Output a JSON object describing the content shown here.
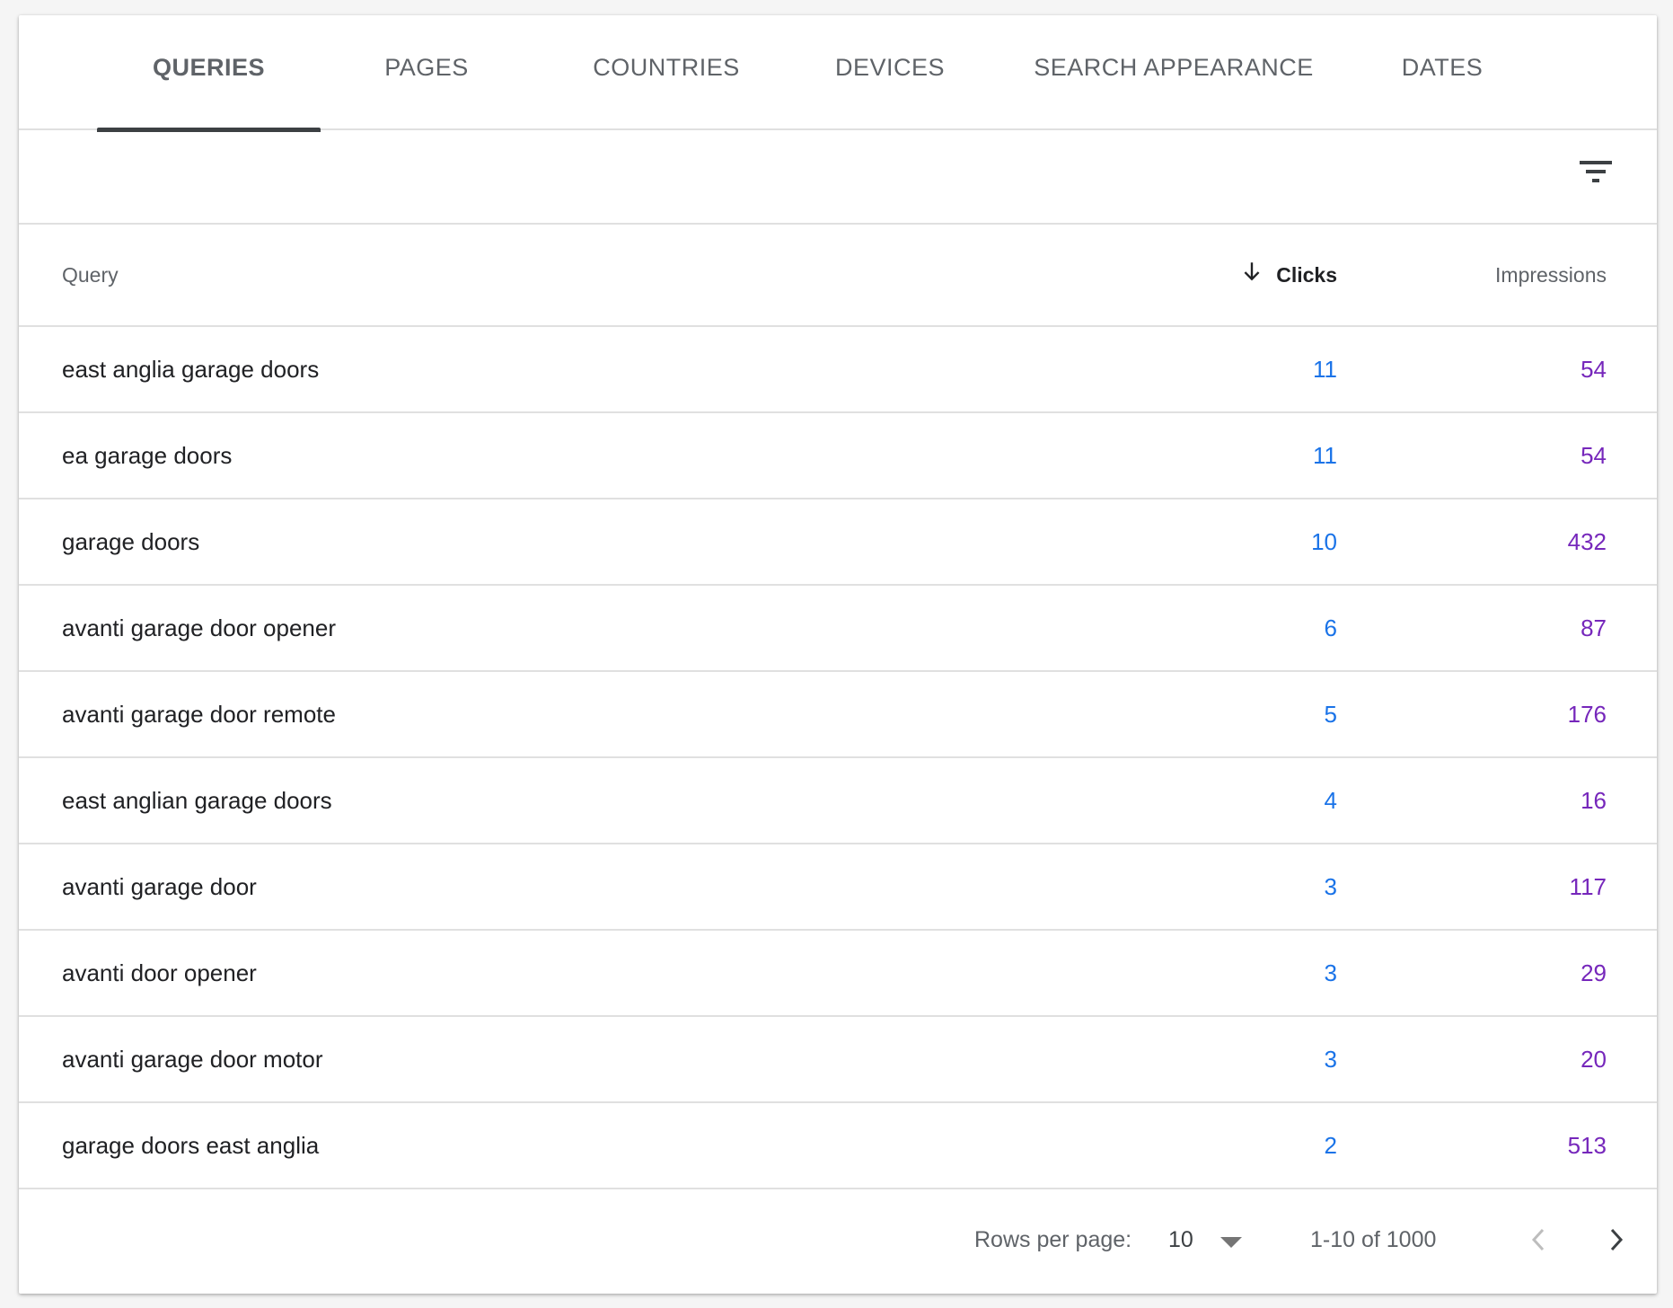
{
  "tabs": [
    {
      "label": "QUERIES",
      "active": true
    },
    {
      "label": "PAGES",
      "active": false
    },
    {
      "label": "COUNTRIES",
      "active": false
    },
    {
      "label": "DEVICES",
      "active": false
    },
    {
      "label": "SEARCH APPEARANCE",
      "active": false
    },
    {
      "label": "DATES",
      "active": false
    }
  ],
  "filter": {
    "icon": "filter-list-icon"
  },
  "table": {
    "headers": {
      "query": "Query",
      "clicks": "Clicks",
      "impressions": "Impressions",
      "sort_icon": "arrow-downward-icon"
    },
    "rows": [
      {
        "query": "east anglia garage doors",
        "clicks": "11",
        "impressions": "54"
      },
      {
        "query": "ea garage doors",
        "clicks": "11",
        "impressions": "54"
      },
      {
        "query": "garage doors",
        "clicks": "10",
        "impressions": "432"
      },
      {
        "query": "avanti garage door opener",
        "clicks": "6",
        "impressions": "87"
      },
      {
        "query": "avanti garage door remote",
        "clicks": "5",
        "impressions": "176"
      },
      {
        "query": "east anglian garage doors",
        "clicks": "4",
        "impressions": "16"
      },
      {
        "query": "avanti garage door",
        "clicks": "3",
        "impressions": "117"
      },
      {
        "query": "avanti door opener",
        "clicks": "3",
        "impressions": "29"
      },
      {
        "query": "avanti garage door motor",
        "clicks": "3",
        "impressions": "20"
      },
      {
        "query": "garage doors east anglia",
        "clicks": "2",
        "impressions": "513"
      }
    ]
  },
  "pagination": {
    "rows_per_page_label": "Rows per page:",
    "rows_per_page_value": "10",
    "range": "1-10 of 1000",
    "prev_icon": "chevron-left-icon",
    "next_icon": "chevron-right-icon"
  },
  "colors": {
    "clicks": "#1a73e8",
    "impressions": "#7627bb",
    "active_tab_indicator": "#3c4043"
  }
}
